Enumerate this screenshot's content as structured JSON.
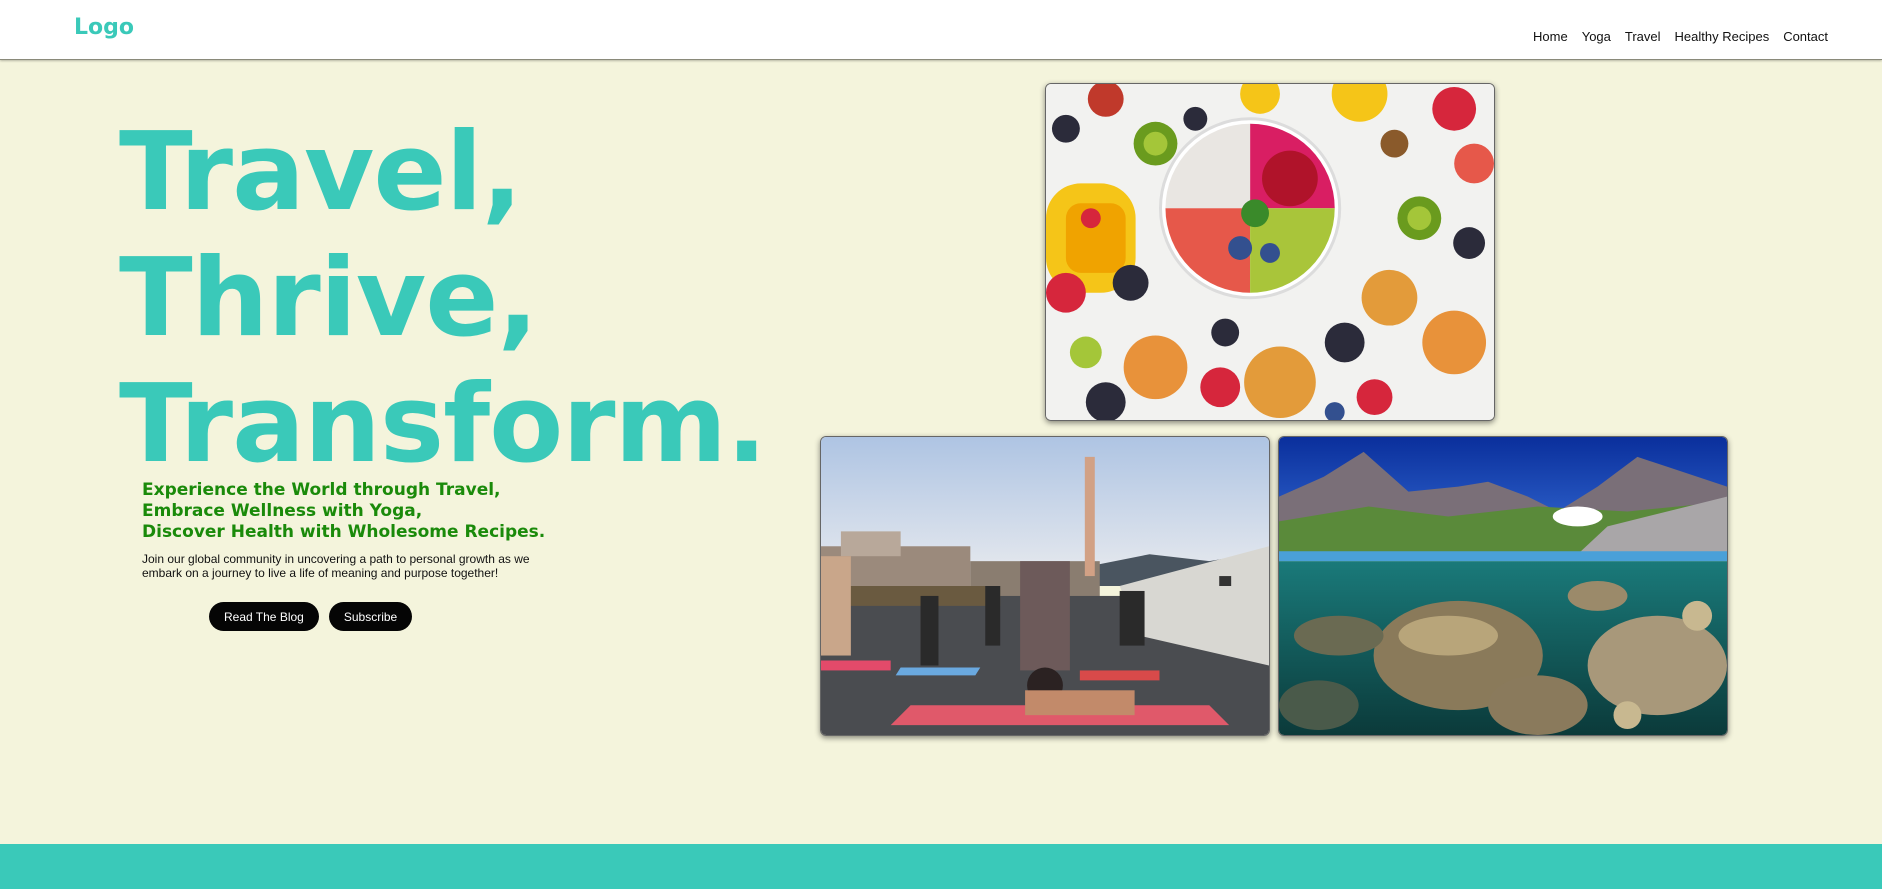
{
  "nav": {
    "logo": "Logo",
    "links": [
      "Home",
      "Yoga",
      "Travel",
      "Healthy Recipes",
      "Contact"
    ]
  },
  "hero": {
    "lines": [
      "Travel,",
      "Thrive,",
      "Transform."
    ]
  },
  "tagline": {
    "lines": [
      "Experience the World through Travel,",
      "Embrace Wellness with Yoga,",
      "Discover Health with Wholesome Recipes."
    ]
  },
  "description": "Join our global community in uncovering a path to personal growth as we embark on a journey to live a life of meaning and purpose together!",
  "buttons": {
    "read_blog": "Read The Blog",
    "subscribe": "Subscribe"
  },
  "colors": {
    "accent": "#3ac9b9",
    "background": "#f4f4dc",
    "tagline": "#1a8a0a",
    "button": "#050505"
  }
}
